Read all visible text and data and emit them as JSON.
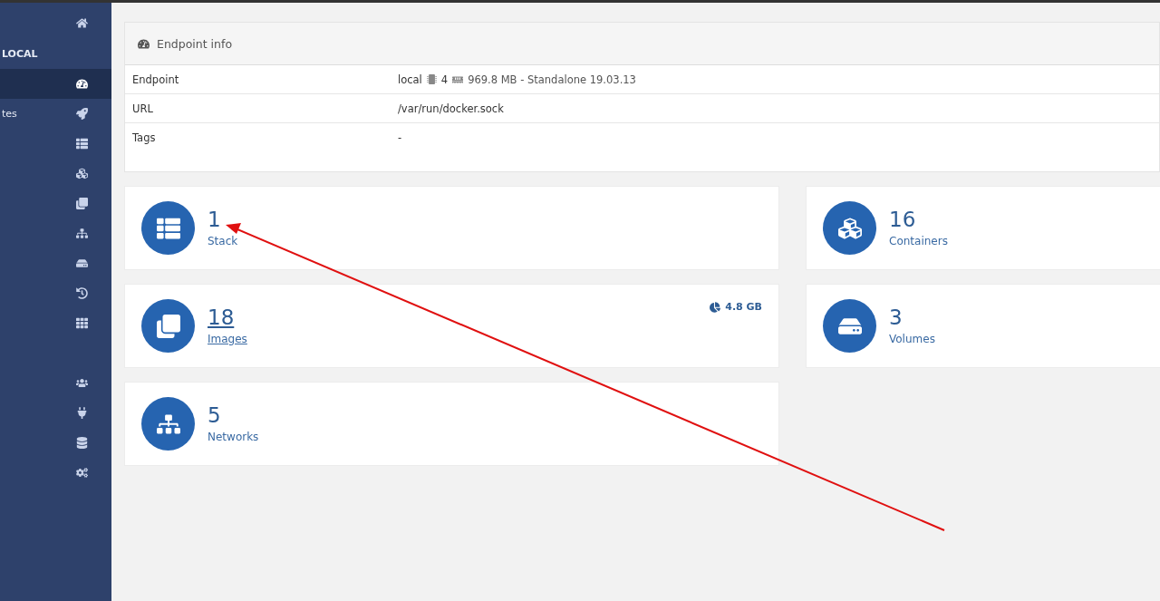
{
  "sidebar": {
    "items": [
      {
        "kind": "icon",
        "selected": false
      },
      {
        "label": "LOCAL",
        "kind": "heading",
        "selected": false
      },
      {
        "kind": "icon",
        "selected": true
      },
      {
        "label": "tes",
        "kind": "link",
        "selected": false
      },
      {
        "kind": "icon",
        "selected": false
      },
      {
        "kind": "icon",
        "selected": false
      },
      {
        "kind": "icon",
        "selected": false
      },
      {
        "kind": "icon",
        "selected": false
      },
      {
        "kind": "icon",
        "selected": false
      },
      {
        "kind": "icon",
        "selected": false
      },
      {
        "kind": "icon",
        "selected": false
      },
      {
        "kind": "icon",
        "selected": false
      },
      {
        "kind": "icon",
        "selected": false
      },
      {
        "kind": "icon",
        "selected": false
      },
      {
        "kind": "icon",
        "selected": false
      }
    ]
  },
  "endpoint_info": {
    "title": "Endpoint info",
    "rows": [
      {
        "label": "Endpoint",
        "value": "local",
        "cpu": "4",
        "memory": "969.8 MB - Standalone 19.03.13"
      },
      {
        "label": "URL",
        "value": "/var/run/docker.sock"
      },
      {
        "label": "Tags",
        "value": "-"
      }
    ]
  },
  "tiles": [
    {
      "value": "1",
      "label": "Stack",
      "hovered": false
    },
    {
      "value": "16",
      "label": "Containers",
      "hovered": false
    },
    {
      "value": "18",
      "label": "Images",
      "hovered": true,
      "size": "4.8 GB"
    },
    {
      "value": "3",
      "label": "Volumes",
      "hovered": false
    },
    {
      "value": "5",
      "label": "Networks",
      "hovered": false
    }
  ],
  "annotation": {
    "kind": "arrow"
  }
}
